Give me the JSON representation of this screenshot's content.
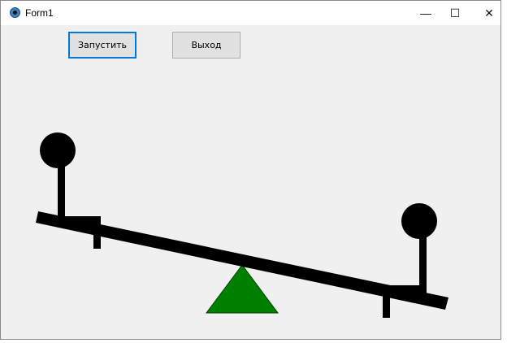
{
  "window": {
    "title": "Form1",
    "minimize": "—",
    "maximize": "☐",
    "close": "✕"
  },
  "buttons": {
    "start": "Запустить",
    "exit": "Выход"
  },
  "colors": {
    "fulcrum": "#008000",
    "beam": "#000000"
  }
}
